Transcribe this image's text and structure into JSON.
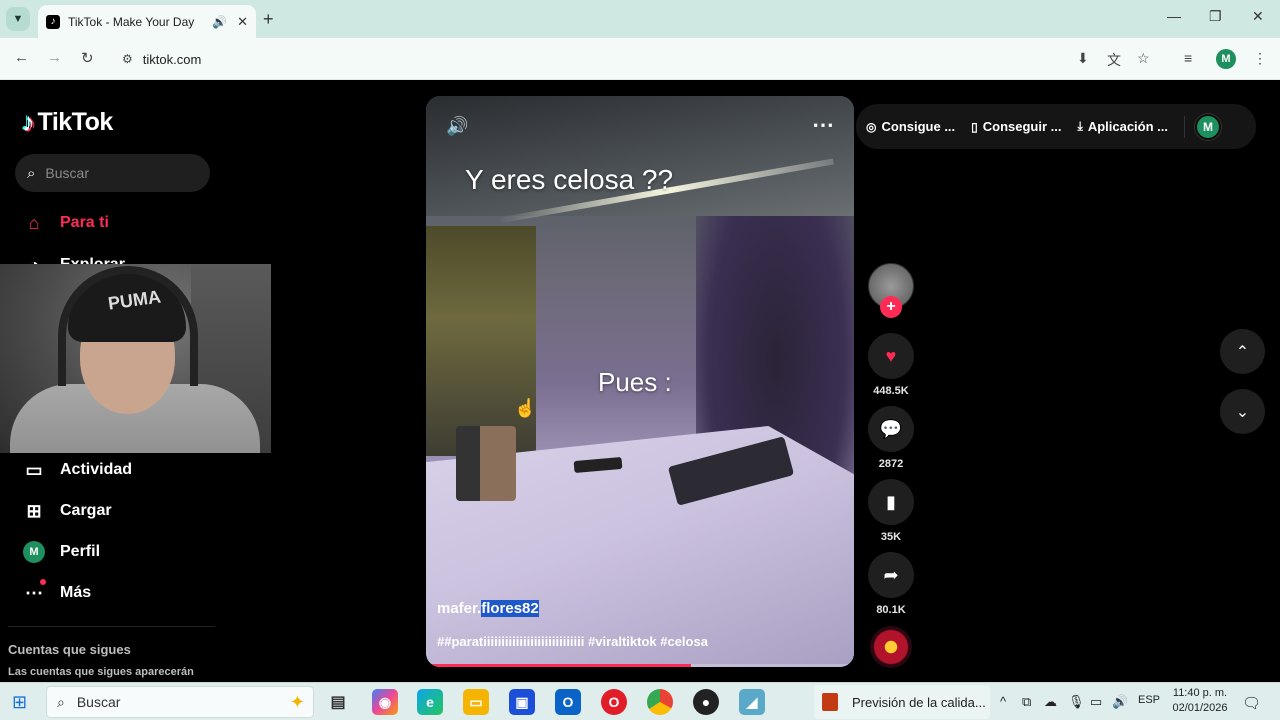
{
  "browser": {
    "tab_title": "TikTok - Make Your Day",
    "url": "tiktok.com",
    "profile_initial": "M"
  },
  "sidebar": {
    "logo": "TikTok",
    "search_placeholder": "Buscar",
    "items": [
      {
        "label": "Para ti"
      },
      {
        "label": "Explorar"
      },
      {
        "label": "Actividad"
      },
      {
        "label": "Cargar"
      },
      {
        "label": "Perfil"
      },
      {
        "label": "Más"
      }
    ],
    "profile_initial": "M",
    "following_title": "Cuentas que sigues",
    "following_sub": "Las cuentas que sigues aparecerán"
  },
  "video": {
    "caption_top": "Y eres celosa ??",
    "caption_mid": "Pues :",
    "author_prefix": "mafer.",
    "author_selected": "flores82",
    "hashtags": "##paratiiiiiiiiiiiiiiiiiiiiiiiiiiii #viraltiktok #celosa",
    "progress": 0.62
  },
  "top_actions": {
    "pill1": "Consigue ...",
    "pill2": "Conseguir ...",
    "pill3": "Aplicación ...",
    "avatar_initial": "M"
  },
  "actions": {
    "likes": "448.5K",
    "comments": "2872",
    "saves": "35K",
    "shares": "80.1K"
  },
  "taskbar": {
    "search_label": "Buscar",
    "active_window": "Previsión de la calida...",
    "language": "ESP",
    "time": "11:40 p. m.",
    "date": "02/01/2026"
  },
  "colors": {
    "accent": "#fe2c55",
    "browser_bg": "#cfe8e1",
    "avatar_green": "#1e8f5e"
  }
}
